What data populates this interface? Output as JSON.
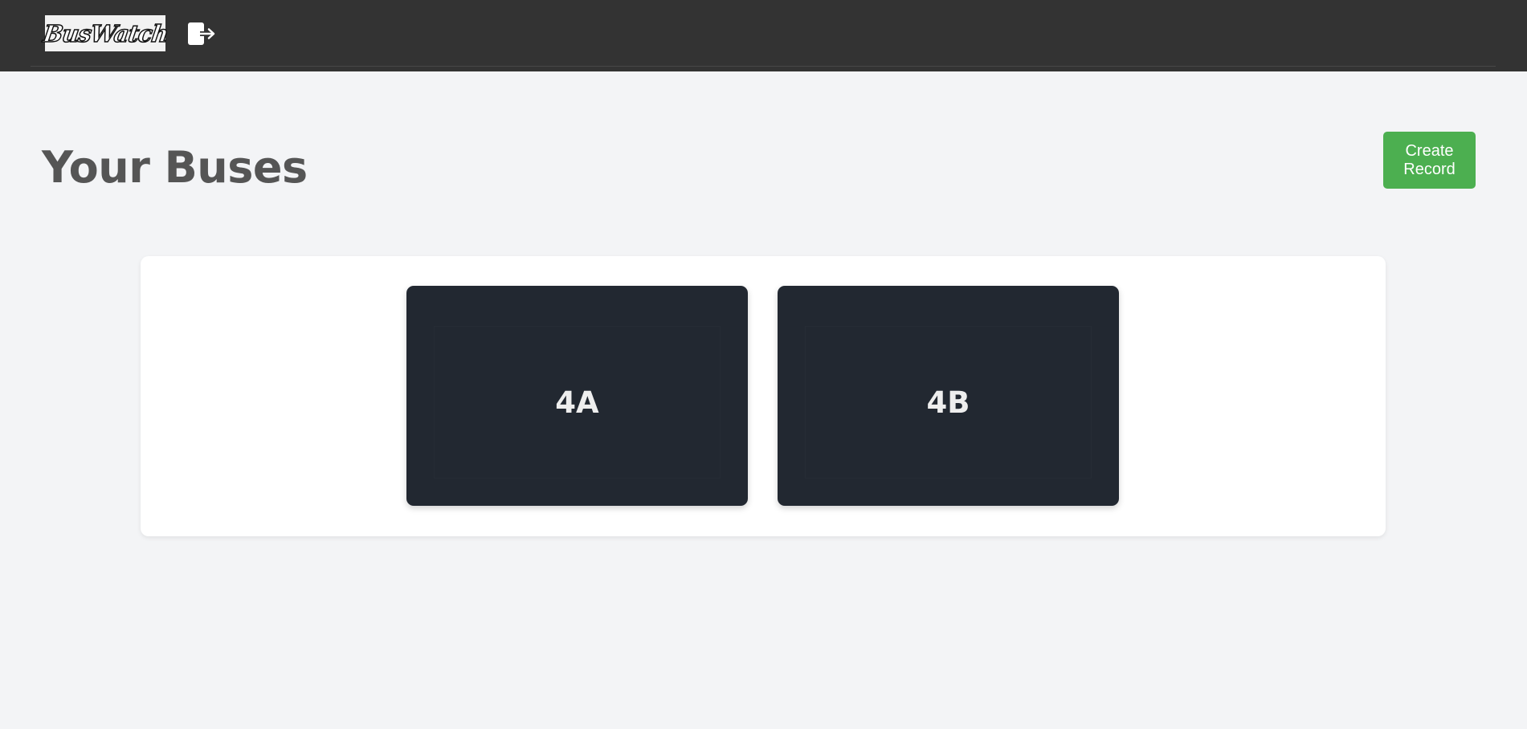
{
  "header": {
    "logo_text": "BusWatch",
    "logout_icon": "logout-icon"
  },
  "main": {
    "title": "Your Buses",
    "create_button_label": "Create Record"
  },
  "buses": [
    {
      "label": "4A"
    },
    {
      "label": "4B"
    }
  ],
  "colors": {
    "topbar": "#333333",
    "background": "#f3f4f6",
    "card": "#222831",
    "primary_button": "#4caf50",
    "title_text": "#555555"
  }
}
